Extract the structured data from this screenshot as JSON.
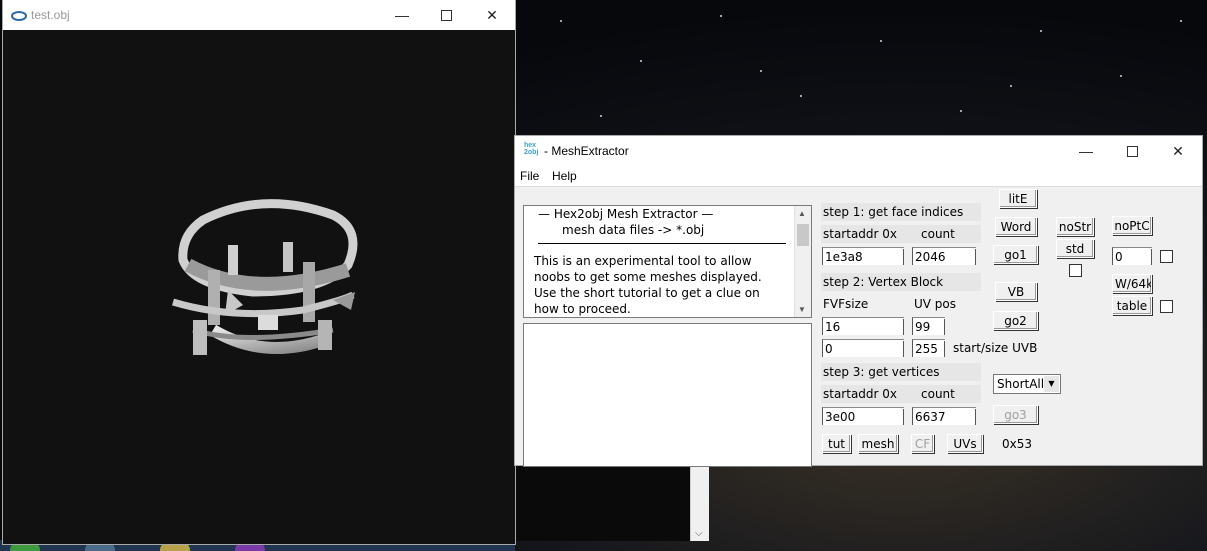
{
  "viewer": {
    "title": "test.obj",
    "app_icon": "viewer-app-icon"
  },
  "mesh_extractor": {
    "title": "- MeshExtractor",
    "app_icon": "hex2obj-icon",
    "menu": [
      "File",
      "Help"
    ],
    "info": {
      "line1": "—   Hex2obj Mesh Extractor   —",
      "line2": "mesh data files -> *.obj",
      "line3": "This is an experimental tool to allow",
      "line4": "noobs to get some meshes displayed.",
      "line5": "Use the short tutorial to get a clue on",
      "line6": "how to proceed."
    },
    "step1": {
      "heading": "step 1: get face indices",
      "startaddr_label": "startaddr 0x",
      "count_label": "count",
      "startaddr_value": "1e3a8",
      "count_value": "2046"
    },
    "step2": {
      "heading": "step 2: Vertex Block",
      "fvfsize_label": "FVFsize",
      "uvpos_label": "UV pos",
      "fvfsize_value": "16",
      "uvpos_value": "99",
      "start_value": "0",
      "size_value": "255",
      "start_size_label": "start/size UVB"
    },
    "step3": {
      "heading": "step 3: get vertices",
      "startaddr_label": "startaddr 0x",
      "count_label": "count",
      "startaddr_value": "3e00",
      "count_value": "6637"
    },
    "buttons": {
      "lite": "litE",
      "word": "Word",
      "go1": "go1",
      "vb": "VB",
      "go2": "go2",
      "go3": "go3",
      "tut": "tut",
      "mesh": "mesh",
      "cf": "CF",
      "uvs": "UVs",
      "nostr": "noStr",
      "std": "std",
      "noptc": "noPtC",
      "w64k": "W/64k",
      "table": "table"
    },
    "combo_value": "ShortAll",
    "small_field_value": "0",
    "hex_readout": "0x53"
  }
}
